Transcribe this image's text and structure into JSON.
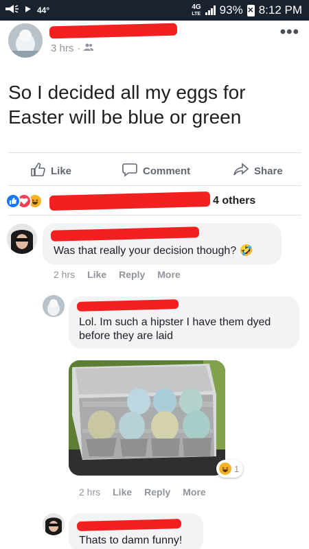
{
  "status_bar": {
    "temperature": "44°",
    "network": "4G",
    "network_sub": "LTE",
    "battery": "93%",
    "time": "8:12 PM"
  },
  "post": {
    "time": "3 hrs",
    "separator": "·",
    "privacy_icon": "friends-icon",
    "text": "So I decided all my eggs for Easter will be blue or green",
    "more_icon": "more-dots-icon"
  },
  "actions": {
    "like": "Like",
    "comment": "Comment",
    "share": "Share"
  },
  "reactions": {
    "others_text": "4 others"
  },
  "comments": [
    {
      "text": "Was that really your decision though? 🤣",
      "time": "2 hrs",
      "like": "Like",
      "reply": "Reply",
      "more": "More"
    },
    {
      "text": "Lol. Im such a hipster I have them dyed before they are laid",
      "time": "2 hrs",
      "like": "Like",
      "reply": "Reply",
      "more": "More",
      "reaction_count": "1"
    },
    {
      "text": "Thats to damn funny!"
    }
  ],
  "colors": {
    "redaction": "#f22020",
    "like_blue": "#1877f2",
    "love_red": "#f33e58",
    "haha_yellow": "#f7b125"
  }
}
